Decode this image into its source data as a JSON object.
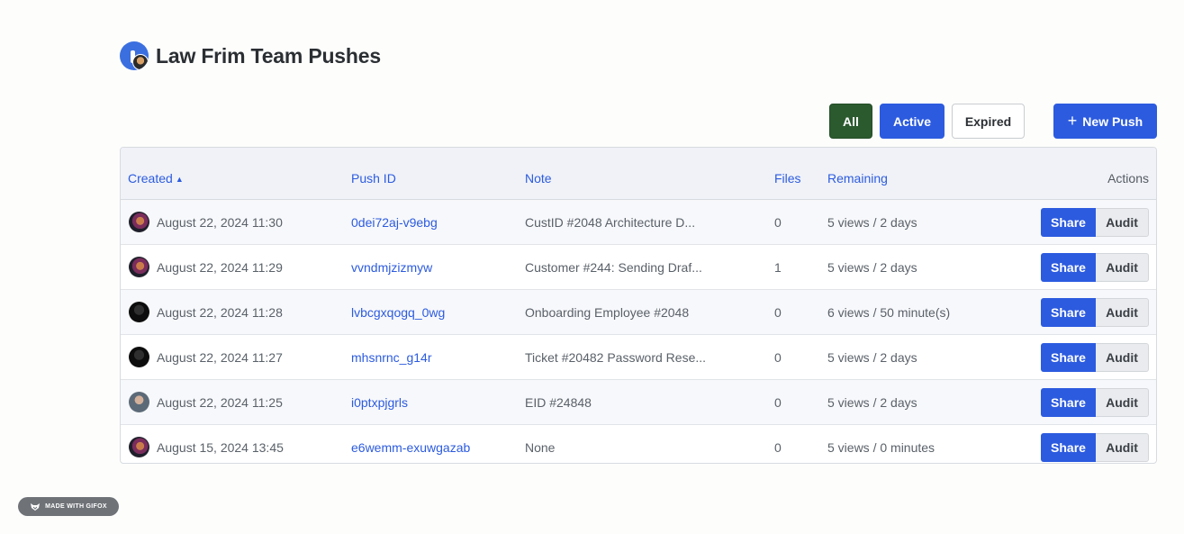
{
  "page": {
    "title": "Law Frim Team Pushes"
  },
  "filters": {
    "all_label": "All",
    "active_label": "Active",
    "expired_label": "Expired",
    "new_push_label": "New Push"
  },
  "table": {
    "columns": {
      "created": "Created",
      "push_id": "Push ID",
      "note": "Note",
      "files": "Files",
      "remaining": "Remaining",
      "actions": "Actions"
    },
    "rows": [
      {
        "avatar": "user-avatar",
        "created": "August 22, 2024 11:30",
        "push_id": "0dei72aj-v9ebg",
        "note": "CustID #2048 Architecture D...",
        "files": "0",
        "remaining": "5 views / 2 days",
        "share": "Share",
        "audit": "Audit"
      },
      {
        "avatar": "user-avatar",
        "created": "August 22, 2024 11:29",
        "push_id": "vvndmjzizmyw",
        "note": "Customer #244: Sending Draf...",
        "files": "1",
        "remaining": "5 views / 2 days",
        "share": "Share",
        "audit": "Audit"
      },
      {
        "avatar": "user-avatar",
        "created": "August 22, 2024 11:28",
        "push_id": "lvbcgxqogq_0wg",
        "note": "Onboarding Employee #2048",
        "files": "0",
        "remaining": "6 views / 50 minute(s)",
        "share": "Share",
        "audit": "Audit"
      },
      {
        "avatar": "user-avatar",
        "created": "August 22, 2024 11:27",
        "push_id": "mhsnrnc_g14r",
        "note": "Ticket #20482 Password Rese...",
        "files": "0",
        "remaining": "5 views / 2 days",
        "share": "Share",
        "audit": "Audit"
      },
      {
        "avatar": "user-avatar",
        "created": "August 22, 2024 11:25",
        "push_id": "i0ptxpjgrls",
        "note": "EID #24848",
        "files": "0",
        "remaining": "5 views / 2 days",
        "share": "Share",
        "audit": "Audit"
      },
      {
        "avatar": "user-avatar",
        "created": "August 15, 2024 13:45",
        "push_id": "e6wemm-exuwgazab",
        "note": "None",
        "files": "0",
        "remaining": "5 views / 0 minutes",
        "share": "Share",
        "audit": "Audit"
      }
    ]
  },
  "watermark": {
    "label": "MADE WITH GIFOX"
  },
  "colors": {
    "primary": "#2c5bdf",
    "all_filter": "#2b5a2e"
  }
}
